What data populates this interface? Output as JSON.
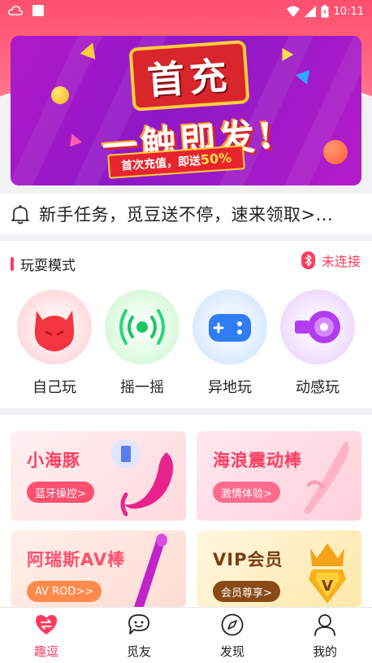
{
  "status_bar": {
    "time": "10:11"
  },
  "banner": {
    "line1": "首充",
    "line2": "一触即发!",
    "ribbon_prefix": "首次充值，即送",
    "ribbon_highlight": "50%"
  },
  "notice": {
    "text": "新手任务，觅豆送不停，速来领取>..."
  },
  "modes": {
    "title": "玩耍模式",
    "bluetooth_status": "未连接",
    "items": [
      {
        "label": "自己玩",
        "icon": "devil-icon"
      },
      {
        "label": "摇一摇",
        "icon": "shake-signal-icon"
      },
      {
        "label": "异地玩",
        "icon": "gamepad-icon"
      },
      {
        "label": "动感玩",
        "icon": "speaker-icon"
      }
    ]
  },
  "products": [
    {
      "title": "小海豚",
      "button": "蓝牙操控>",
      "title_color": "#ff3b5f",
      "button_color": "#ff4f6e"
    },
    {
      "title": "海浪震动棒",
      "button": "激情体验>",
      "title_color": "#ff3b5f",
      "button_color": "#ff5f8a"
    },
    {
      "title": "阿瑞斯AV棒",
      "button": "AV ROD>>",
      "title_color": "#ff4f6e",
      "button_color": "#ff8a4a"
    },
    {
      "title": "VIP会员",
      "button": "会员尊享>",
      "title_color": "#7a3e12",
      "button_color": "#8a4a18",
      "badge": "V"
    }
  ],
  "tabbar": {
    "items": [
      {
        "label": "趣逗",
        "active": true
      },
      {
        "label": "觅友",
        "active": false
      },
      {
        "label": "发现",
        "active": false
      },
      {
        "label": "我的",
        "active": false
      }
    ]
  },
  "colors": {
    "accent": "#ff3b5f",
    "header": "#ff4f6e",
    "banner_purple": "#8d18c7"
  }
}
